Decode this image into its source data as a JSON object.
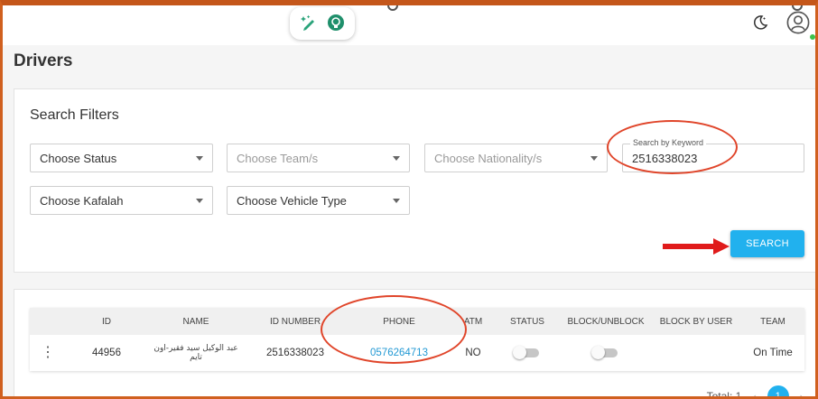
{
  "header": {
    "icons": [
      "edit-sparkle-icon",
      "lightbulb-icon",
      "moon-icon",
      "user-avatar-icon"
    ]
  },
  "page": {
    "title": "Drivers"
  },
  "filters": {
    "title": "Search Filters",
    "status": "Choose Status",
    "team": "Choose Team/s",
    "nationality": "Choose Nationality/s",
    "kafalah": "Choose Kafalah",
    "vehicle_type": "Choose Vehicle Type",
    "keyword_label": "Search by Keyword",
    "keyword_value": "2516338023",
    "search_label": "SEARCH"
  },
  "table": {
    "columns": [
      "ID",
      "NAME",
      "ID NUMBER",
      "PHONE",
      "ATM",
      "STATUS",
      "BLOCK/UNBLOCK",
      "BLOCK BY USER",
      "TEAM"
    ],
    "rows": [
      {
        "id": "44956",
        "name": "عبد الوكيل سيد فقير-اون تايم",
        "id_number": "2516338023",
        "phone": "0576264713",
        "atm": "NO",
        "status_on": false,
        "block_on": false,
        "block_by_user": "",
        "team": "On Time"
      }
    ]
  },
  "pagination": {
    "total_label": "Total: 1",
    "current_page": "1"
  },
  "colors": {
    "accent": "#21b1ee",
    "annotation": "#e0452a",
    "frame": "#c85a1e"
  }
}
